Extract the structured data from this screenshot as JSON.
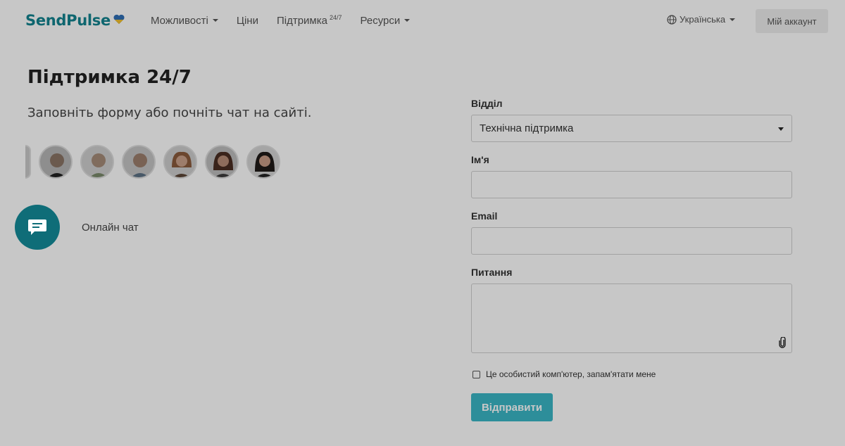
{
  "header": {
    "logo_text": "SendPulse",
    "nav": [
      {
        "label": "Можливості",
        "has_caret": true
      },
      {
        "label": "Ціни",
        "has_caret": false
      },
      {
        "label": "Підтримка",
        "sup": "24/7",
        "active": true
      },
      {
        "label": "Ресурси",
        "has_caret": true
      }
    ],
    "language": "Українська",
    "account_label": "Мій аккаунт"
  },
  "main": {
    "title": "Підтримка 24/7",
    "subtitle": "Заповніть форму або почніть чат на сайті.",
    "chat_label": "Онлайн чат"
  },
  "form": {
    "department_label": "Відділ",
    "department_value": "Технічна підтримка",
    "name_label": "Ім'я",
    "name_value": "",
    "email_label": "Email",
    "email_value": "",
    "question_label": "Питання",
    "question_value": "",
    "remember_label": "Це особистий комп'ютер, запам'ятати мене",
    "submit_label": "Відправити"
  },
  "colors": {
    "brand": "#13838f",
    "chat_button": "#0f6d78",
    "submit": "#3ab6c6"
  }
}
